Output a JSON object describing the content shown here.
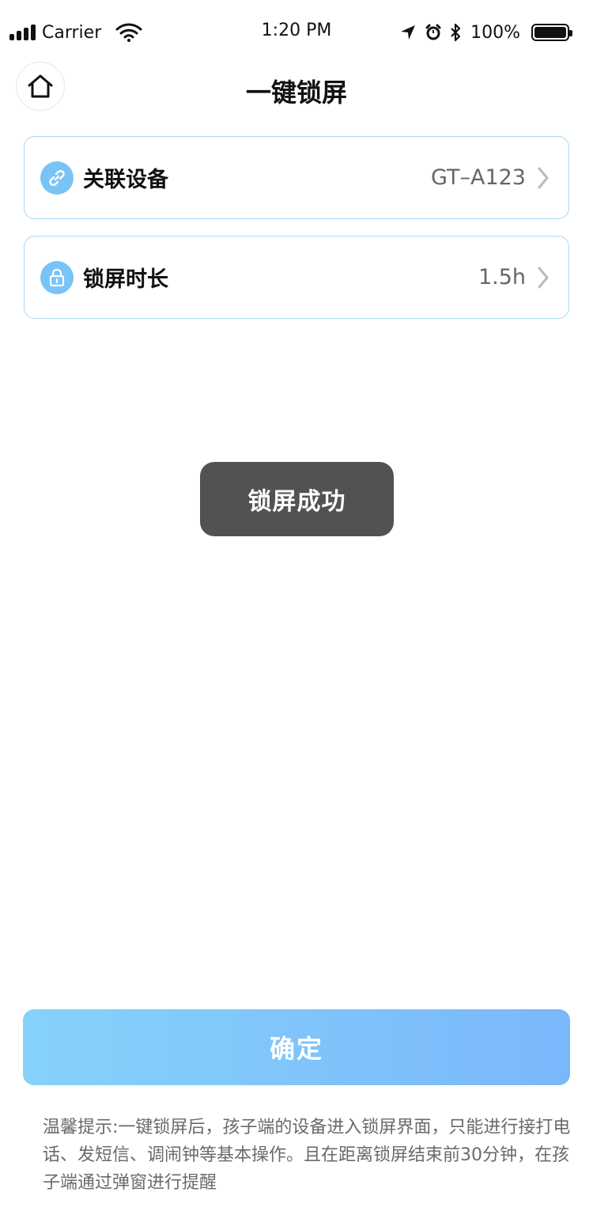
{
  "status_bar": {
    "carrier": "Carrier",
    "time": "1:20 PM",
    "battery": "100%"
  },
  "header": {
    "title": "一键锁屏",
    "home_icon": "home-icon"
  },
  "settings": [
    {
      "label": "关联设备",
      "value": "GT–A123",
      "icon": "link-icon"
    },
    {
      "label": "锁屏时长",
      "value": "1.5h",
      "icon": "lock-icon"
    }
  ],
  "toast": {
    "text": "锁屏成功"
  },
  "confirm_button": {
    "label": "确定"
  },
  "tip": {
    "text": "温馨提示:一键锁屏后，孩子端的设备进入锁屏界面，只能进行接打电话、发短信、调闹钟等基本操作。且在距离锁屏结束前30分钟，在孩子端通过弹窗进行提醒"
  },
  "colors": {
    "accent": "#79c3f6",
    "card_border": "#a8d8f7",
    "button_gradient_start": "#85d2fb",
    "button_gradient_end": "#7ab7fb",
    "toast_bg": "#525252"
  }
}
